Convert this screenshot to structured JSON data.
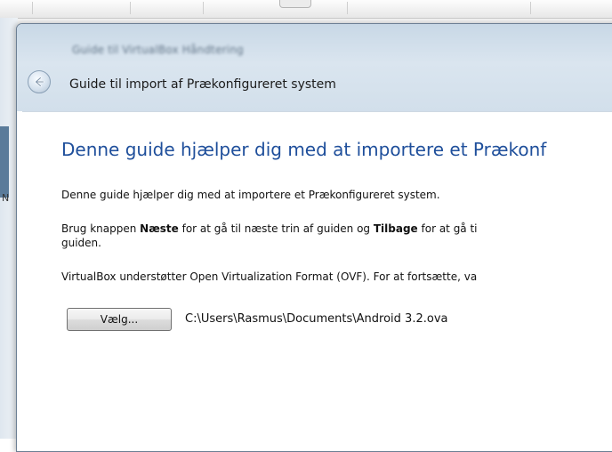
{
  "window": {
    "blurred_title": "Guide til VirtualBox Håndtering"
  },
  "wizard": {
    "title": "Guide til import af Prækonfigureret system",
    "heading": "Denne guide hjælper dig med at importere et Prækonf",
    "intro": "Denne guide hjælper dig med at importere et Prækonfigureret system.",
    "nav_line": {
      "part1": "Brug knappen ",
      "next_label": "Næste",
      "part2": " for at gå til næste trin af guiden og ",
      "back_label": "Tilbage",
      "part3": " for at gå ti",
      "part4": "guiden."
    },
    "ovf_text": "VirtualBox understøtter Open Virtualization Format (OVF). For at fortsætte, va",
    "choose_button_label": "Vælg...",
    "file_path": "C:\\Users\\Rasmus\\Documents\\Android 3.2.ova"
  },
  "background": {
    "side_letter": "N"
  },
  "icons": {
    "back": "back-arrow-icon"
  },
  "colors": {
    "heading": "#1f4f9b",
    "frame": "#d2dfeb"
  }
}
